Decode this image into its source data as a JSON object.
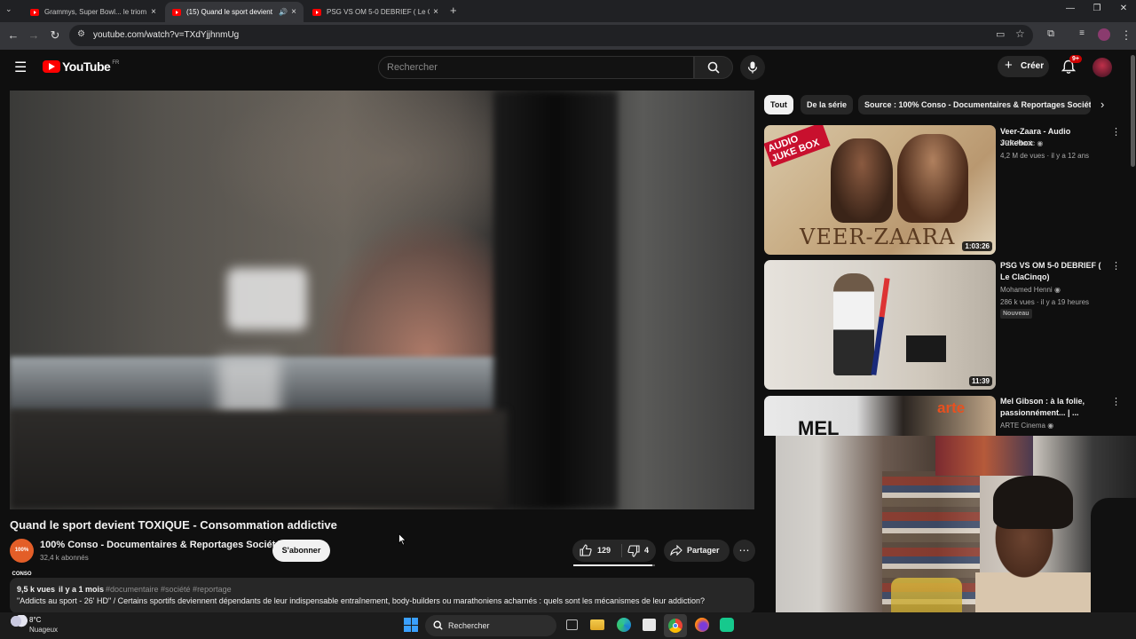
{
  "browser": {
    "tabs": [
      {
        "label": "Grammys, Super Bowl... le triom"
      },
      {
        "label": "(15) Quand le sport devient"
      },
      {
        "label": "PSG VS OM 5-0 DEBRIEF ( Le Cl"
      }
    ],
    "url": "youtube.com/watch?v=TXdYjjhnmUg"
  },
  "yt": {
    "logo": "YouTube",
    "region": "FR",
    "search_placeholder": "Rechercher",
    "create_label": "Créer",
    "notif_count": "9+"
  },
  "video": {
    "title": "Quand le sport devient TOXIQUE - Consommation addictive",
    "channel": "100% Conso - Documentaires & Reportages Société",
    "channel_avatar_text": "100% CONSO",
    "subscribers": "32,4 k abonnés",
    "subscribe_label": "S'abonner",
    "likes": "129",
    "dislikes": "4",
    "share_label": "Partager",
    "views": "9,5 k vues",
    "age": "il y a 1 mois",
    "tags": "#documentaire #société #reportage",
    "description": "\"Addicts au sport - 26' HD\" / Certains sportifs deviennent dépendants de leur indispensable entraînement, body-builders ou marathoniens acharnés : quels sont les mécanismes de leur addiction?"
  },
  "chips": [
    "Tout",
    "De la série",
    "Source : 100% Conso - Documentaires & Reportages Société"
  ],
  "related": [
    {
      "title": "Veer-Zaara - Audio Jukebox",
      "channel": "YRF Music",
      "meta": "4,2 M de vues · il y a 12 ans",
      "duration": "1:03:26",
      "thumb_text": "VEER-ZAARA",
      "thumb_tag": "AUDIO JUKE BOX"
    },
    {
      "title": "PSG VS OM 5-0 DEBRIEF ( Le ClaCinqo)",
      "channel": "Mohamed Henni",
      "meta": "286 k vues · il y a 19 heures",
      "badge": "Nouveau",
      "duration": "11:39"
    },
    {
      "title": "Mel Gibson : à la folie, passionnément... | ...",
      "channel": "ARTE Cinema",
      "thumb_text": "MEL",
      "thumb_tag": "arte"
    }
  ],
  "taskbar": {
    "temp": "8°C",
    "weather": "Nuageux",
    "search_label": "Rechercher"
  }
}
